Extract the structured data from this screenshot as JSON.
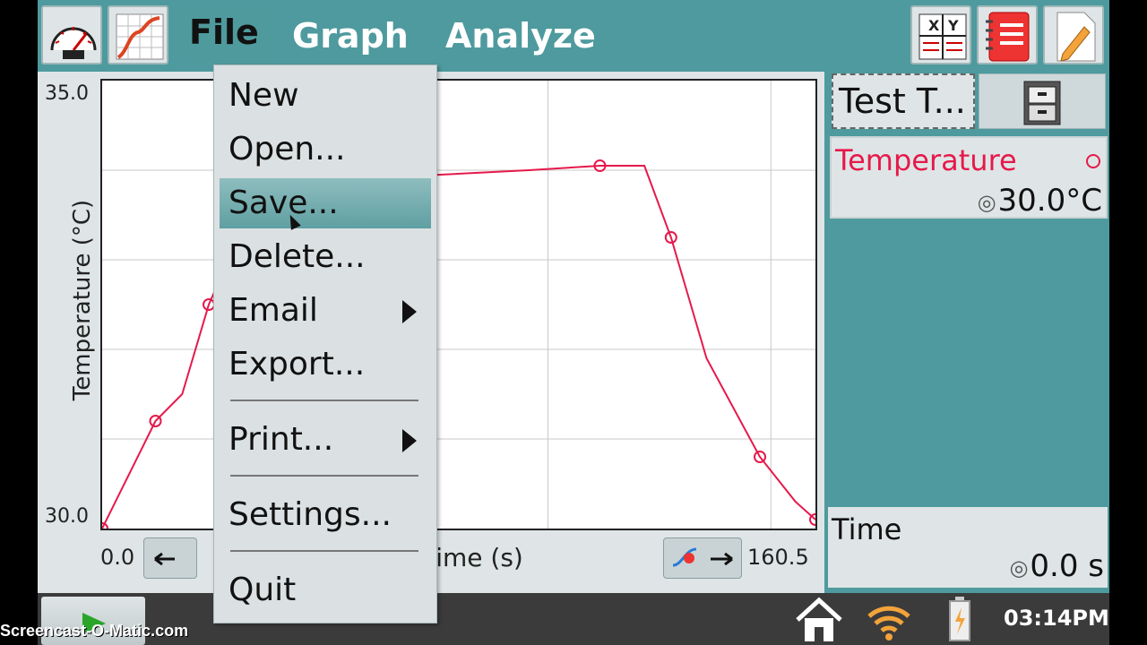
{
  "toolbar": {
    "gauge_icon": "meter-icon",
    "graph_icon": "graph-icon",
    "menus": [
      "File",
      "Graph",
      "Analyze"
    ],
    "right_icons": [
      "table-icon",
      "notes-icon",
      "edit-icon"
    ]
  },
  "file_menu": {
    "items": [
      "New",
      "Open...",
      "Save...",
      "Delete...",
      "Email",
      "Export...",
      "Print...",
      "Settings...",
      "Quit"
    ],
    "selected": "Save..."
  },
  "graph": {
    "y_top": "35.0",
    "y_bottom": "30.0",
    "y_label": "Temperature (°C)",
    "x_left": "0.0",
    "x_right": "160.5",
    "x_label": "Time (s)"
  },
  "chart_data": {
    "type": "line",
    "series": [
      {
        "name": "Temperature",
        "x": [
          0,
          12,
          18,
          24,
          32,
          40,
          52,
          72,
          96,
          112,
          122,
          128,
          136,
          148,
          156,
          160.5
        ],
        "y": [
          30.0,
          31.2,
          31.5,
          32.5,
          33.4,
          33.8,
          33.88,
          33.94,
          34.0,
          34.05,
          34.05,
          33.25,
          31.9,
          30.8,
          30.3,
          30.1
        ]
      }
    ],
    "xlim": [
      0,
      160.5
    ],
    "ylim": [
      30.0,
      35.0
    ],
    "color": "#e6194b"
  },
  "right_panel": {
    "test_button": "Test T...",
    "sensor_name": "Temperature",
    "sensor_value": "30.0°C",
    "time_name": "Time",
    "time_value": "0.0 s",
    "zero_icon": "◎"
  },
  "status": {
    "clock": "03:14PM",
    "watermark": "Screencast-O-Matic.com"
  },
  "colors": {
    "teal": "#4e9a9e",
    "red": "#e6194b"
  }
}
